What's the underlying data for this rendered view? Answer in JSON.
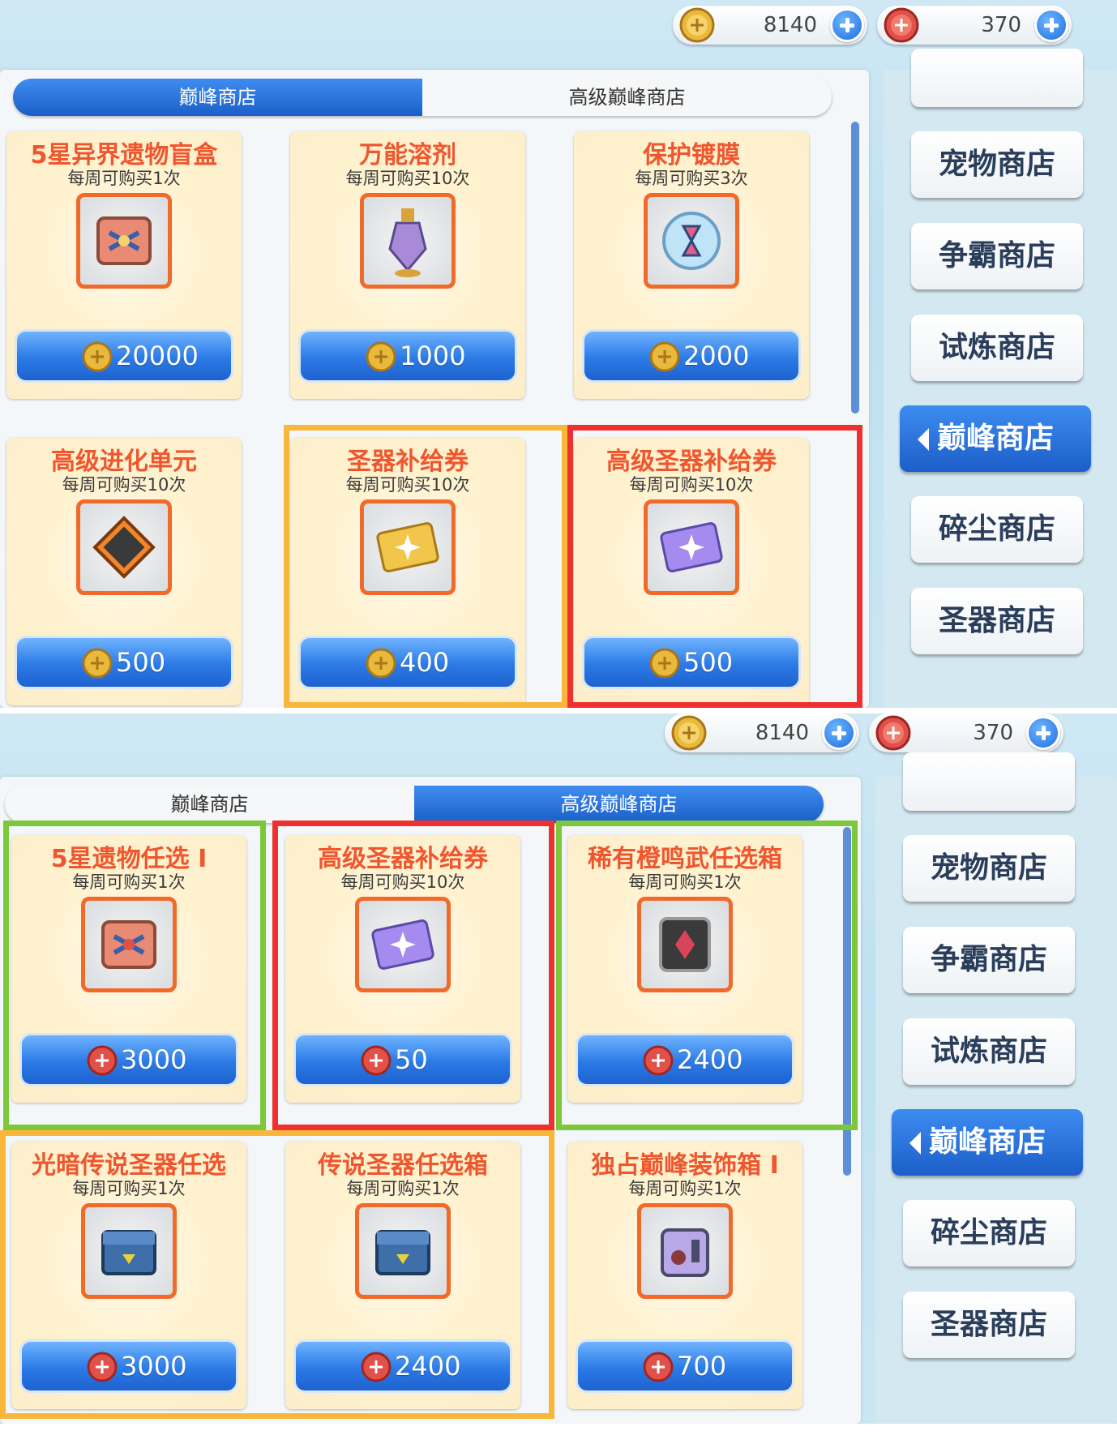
{
  "colors": {
    "highlight_yellow": "#f8b73a",
    "highlight_red": "#ee3030",
    "highlight_green": "#7cc83a",
    "accent_blue": "#1f6fe0"
  },
  "top": {
    "currency": {
      "gold_amount": "8140",
      "red_amount": "370",
      "gold_icon": "gold-coin-icon",
      "red_icon": "red-coin-icon"
    },
    "tabs": [
      "巅峰商店",
      "高级巅峰商店"
    ],
    "active_tab": 0,
    "items": [
      {
        "name": "5星异界遗物盲盒",
        "limit": "每周可购买1次",
        "price": "20000",
        "currency": "gold",
        "icon": "relic-box-icon"
      },
      {
        "name": "万能溶剂",
        "limit": "每周可购买10次",
        "price": "1000",
        "currency": "gold",
        "icon": "potion-bottle-icon"
      },
      {
        "name": "保护镀膜",
        "limit": "每周可购买3次",
        "price": "2000",
        "currency": "gold",
        "icon": "crystal-orb-icon"
      },
      {
        "name": "高级进化单元",
        "limit": "每周可购买10次",
        "price": "500",
        "currency": "gold",
        "icon": "evolution-unit-icon"
      },
      {
        "name": "圣器补给券",
        "limit": "每周可购买10次",
        "price": "400",
        "currency": "gold",
        "icon": "gold-ticket-icon"
      },
      {
        "name": "高级圣器补给券",
        "limit": "每周可购买10次",
        "price": "500",
        "currency": "gold",
        "icon": "purple-ticket-icon"
      }
    ],
    "nav": [
      "宠物商店",
      "争霸商店",
      "试炼商店",
      "巅峰商店",
      "碎尘商店",
      "圣器商店"
    ],
    "nav_active": 3
  },
  "bottom": {
    "currency": {
      "gold_amount": "8140",
      "red_amount": "370",
      "gold_icon": "gold-coin-icon",
      "red_icon": "red-coin-icon"
    },
    "tabs": [
      "巅峰商店",
      "高级巅峰商店"
    ],
    "active_tab": 1,
    "items": [
      {
        "name": "5星遗物任选 I",
        "limit": "每周可购买1次",
        "price": "3000",
        "currency": "red",
        "icon": "relic-box-icon"
      },
      {
        "name": "高级圣器补给券",
        "limit": "每周可购买10次",
        "price": "50",
        "currency": "red",
        "icon": "purple-ticket-icon"
      },
      {
        "name": "稀有橙鸣武任选箱",
        "limit": "每周可购买1次",
        "price": "2400",
        "currency": "red",
        "icon": "weapon-box-icon"
      },
      {
        "name": "光暗传说圣器任选",
        "limit": "每周可购买1次",
        "price": "3000",
        "currency": "red",
        "icon": "blue-chest-icon"
      },
      {
        "name": "传说圣器任选箱",
        "limit": "每周可购买1次",
        "price": "2400",
        "currency": "red",
        "icon": "blue-chest-icon"
      },
      {
        "name": "独占巅峰装饰箱 I",
        "limit": "每周可购买1次",
        "price": "700",
        "currency": "red",
        "icon": "purple-box-icon"
      }
    ],
    "nav": [
      "宠物商店",
      "争霸商店",
      "试炼商店",
      "巅峰商店",
      "碎尘商店",
      "圣器商店"
    ],
    "nav_active": 3
  }
}
